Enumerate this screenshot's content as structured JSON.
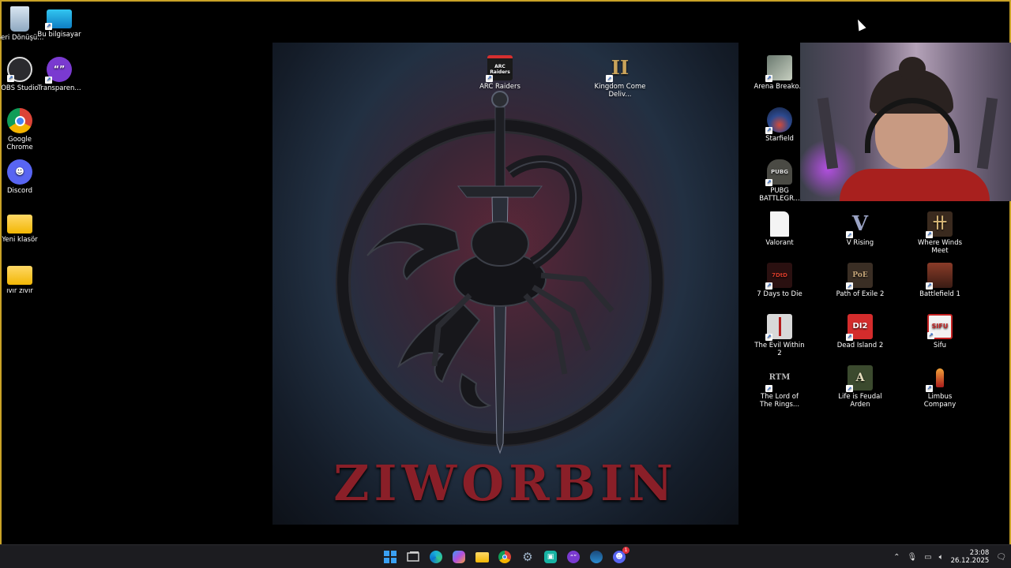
{
  "desktop_icons": {
    "recycle_bin": "Geri Dönüşü...",
    "this_pc": "Bu bilgisayar",
    "obs": "OBS Studio",
    "transparent": "Transparen...",
    "chrome": "Google Chrome",
    "discord": "Discord",
    "new_folder": "Yeni klasör",
    "ivir_zivir": "ıvır zıvır",
    "arc_raiders": "ARC Raiders",
    "kingdom_come": "Kingdom Come Deliv...",
    "arena_breakout": "Arena Breako...",
    "starfield": "Starfield",
    "pubg": "PUBG BATTLEGR...",
    "valorant": "Valorant",
    "v_rising": "V Rising",
    "where_winds_meet": "Where Winds Meet",
    "seven_days": "7 Days to Die",
    "path_of_exile": "Path of Exile 2",
    "battlefield": "Battlefield 1",
    "evil_within": "The Evil Within 2",
    "dead_island": "Dead Island 2",
    "sifu": "Sifu",
    "lotr": "The Lord of The Rings...",
    "life_is_feudal": "Life is Feudal Arden",
    "limbus": "Limbus Company"
  },
  "icon_glyphs": {
    "arc": "ARC Raiders",
    "kingdom": "II",
    "pubg": "PUBG",
    "vrising": "V",
    "wwm": "卄",
    "seven": "7DtD",
    "poe": "PoE",
    "dead_island": "DI2",
    "sifu": "SIFU",
    "lotr": "RTM",
    "lif": "A"
  },
  "wallpaper": {
    "title": "ZIWORBIN"
  },
  "taskbar": {
    "time": "23:08",
    "date": "26.12.2025",
    "discord_badge": "1"
  },
  "colors": {
    "frame": "#c9a227",
    "taskbar": "#1c1c20",
    "wallpaper_title": "#8a1f28"
  }
}
